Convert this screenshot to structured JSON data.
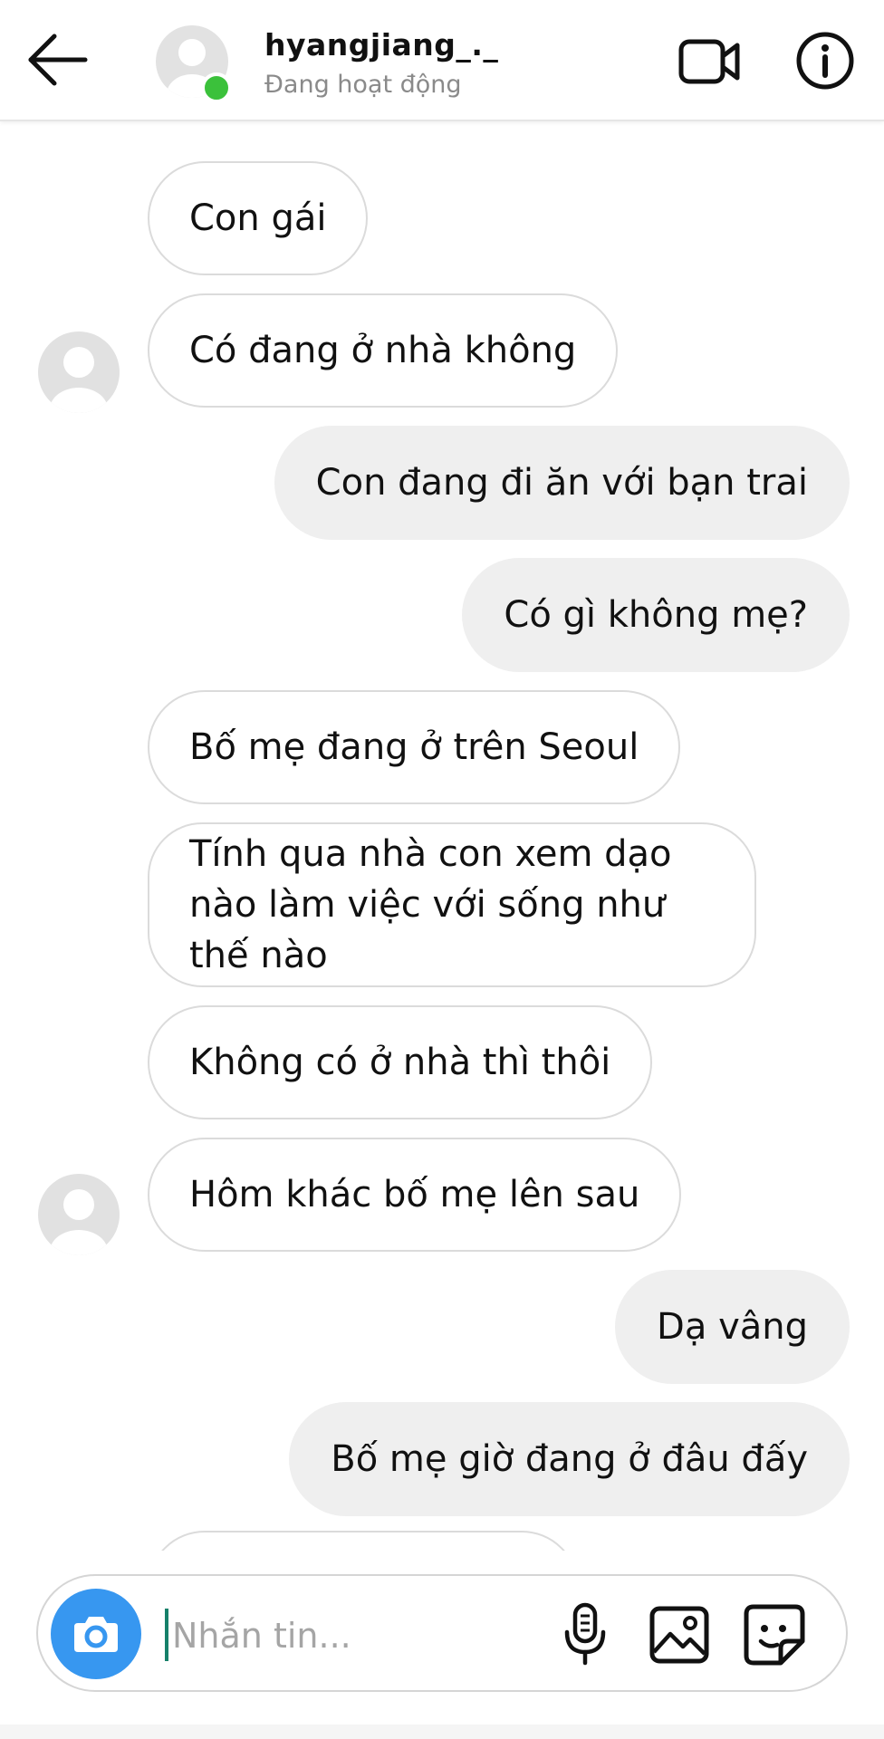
{
  "header": {
    "username": "hyangjiang_._",
    "status": "Đang hoạt động",
    "back_icon": "arrow-left-icon",
    "video_icon": "video-camera-icon",
    "info_icon": "info-icon"
  },
  "messages": [
    {
      "side": "incoming",
      "text": "Con gái"
    },
    {
      "side": "incoming",
      "text": "Có đang ở nhà không"
    },
    {
      "side": "outgoing",
      "text": "Con đang đi ăn với bạn trai"
    },
    {
      "side": "outgoing",
      "text": "Có gì không mẹ?"
    },
    {
      "side": "incoming",
      "text": "Bố mẹ đang ở trên Seoul"
    },
    {
      "side": "incoming",
      "text": "Tính qua nhà con xem dạo nào làm việc với sống như thế nào"
    },
    {
      "side": "incoming",
      "text": "Không có ở nhà thì thôi"
    },
    {
      "side": "incoming",
      "text": "Hôm khác bố mẹ lên sau"
    },
    {
      "side": "outgoing",
      "text": "Dạ vâng"
    },
    {
      "side": "outgoing",
      "text": "Bố mẹ giờ đang ở đâu đấy"
    }
  ],
  "composer": {
    "placeholder": "Nhắn tin...",
    "value": "",
    "camera_icon": "camera-icon",
    "mic_icon": "microphone-icon",
    "gallery_icon": "image-gallery-icon",
    "sticker_icon": "sticker-icon"
  },
  "colors": {
    "online": "#3bc13b",
    "camera_button": "#3797f0",
    "outgoing_bubble": "#efefef",
    "incoming_border": "#dbdbdb"
  }
}
